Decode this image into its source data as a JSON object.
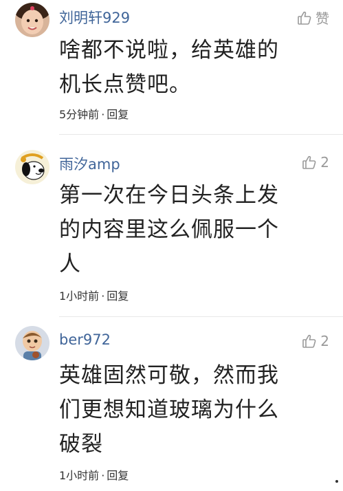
{
  "comments": [
    {
      "username": "刘明轩929",
      "like_label": "赞",
      "text_lines": [
        "啥都不说啦，给英雄的",
        "机长点赞吧。"
      ],
      "time": "5分钟前",
      "dot": "·",
      "reply": "回复",
      "avatar": "avatar-girl-photo"
    },
    {
      "username": "雨汐amp",
      "like_label": "2",
      "text_lines": [
        "第一次在今日头条上发",
        "的内容里这么佩服一个",
        "人"
      ],
      "time": "1小时前",
      "dot": "·",
      "reply": "回复",
      "avatar": "avatar-snoopy"
    },
    {
      "username": "ber972",
      "like_label": "2",
      "text_lines": [
        "英雄固然可敬，然而我",
        "们更想知道玻璃为什么",
        "破裂"
      ],
      "time": "1小时前",
      "dot": "·",
      "reply": "回复",
      "avatar": "avatar-cartoon-boy"
    }
  ],
  "colors": {
    "username": "#406599",
    "like": "#999999",
    "text": "#222222"
  },
  "icons": [
    "thumbs-up-icon"
  ]
}
